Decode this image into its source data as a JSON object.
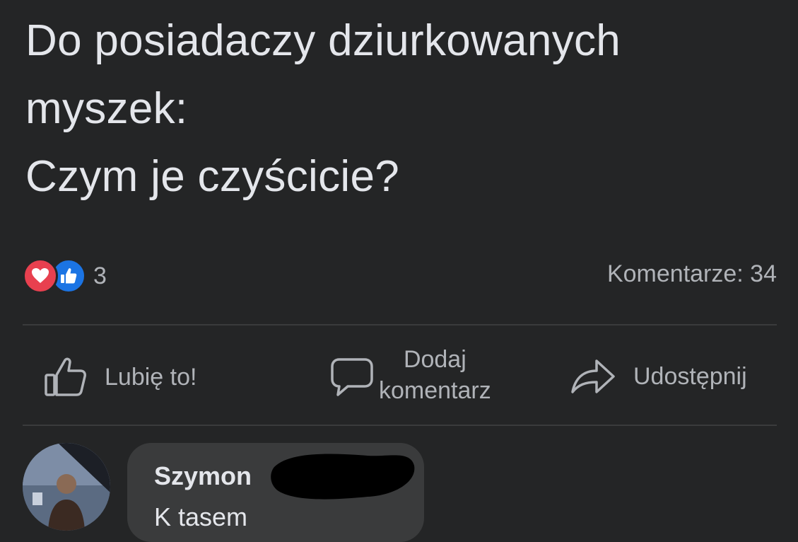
{
  "post": {
    "text_lines": [
      "Do posiadaczy dziurkowanych",
      "myszek:",
      "Czym je czyścicie?"
    ]
  },
  "reactions": {
    "icons": [
      "heart-icon",
      "thumbs-up-icon"
    ],
    "count": "3",
    "love_color": "#e8404f",
    "like_color": "#1b74e4"
  },
  "comments_summary": "Komentarze: 34",
  "actions": {
    "like_label": "Lubię to!",
    "comment_label_line1": "Dodaj",
    "comment_label_line2": "komentarz",
    "share_label": "Udostępnij",
    "like_icon": "thumbs-up-outline-icon",
    "comment_icon": "speech-bubble-icon",
    "share_icon": "share-arrow-icon"
  },
  "comment": {
    "author": "Szymon",
    "body": "K tasem"
  },
  "colors": {
    "background": "#242526",
    "text_primary": "#e4e6eb",
    "text_secondary": "#b0b3b8",
    "divider": "#3a3b3c",
    "bubble": "#3a3b3c"
  }
}
